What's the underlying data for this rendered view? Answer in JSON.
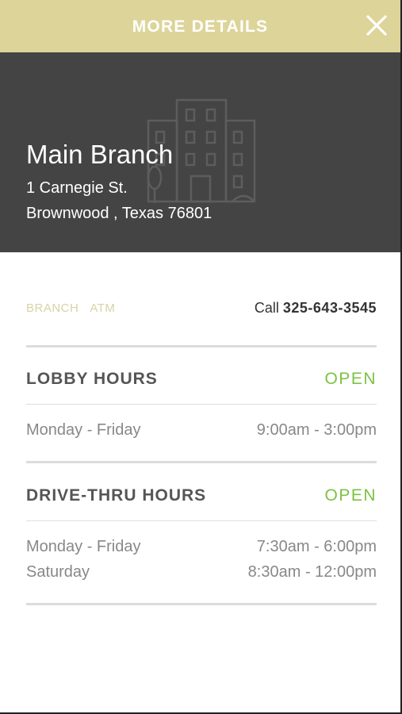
{
  "header": {
    "title": "MORE DETAILS"
  },
  "branch": {
    "name": "Main Branch",
    "address_line1": "1 Carnegie St.",
    "address_line2": "Brownwood , Texas 76801"
  },
  "tabs": [
    "BRANCH",
    "ATM"
  ],
  "contact": {
    "call_label": "Call",
    "phone": "325-643-3545"
  },
  "lobby": {
    "title": "LOBBY HOURS",
    "status": "OPEN",
    "rows": [
      {
        "days": "Monday - Friday",
        "hours": "9:00am - 3:00pm"
      }
    ]
  },
  "drive_thru": {
    "title": "DRIVE-THRU HOURS",
    "status": "OPEN",
    "rows": [
      {
        "days": "Monday - Friday",
        "hours": "7:30am - 6:00pm"
      },
      {
        "days": "Saturday",
        "hours": "8:30am - 12:00pm"
      }
    ]
  },
  "colors": {
    "header": "#ddd49a",
    "hero": "#444444",
    "open": "#7cc242",
    "tab": "#d7d3a4"
  }
}
